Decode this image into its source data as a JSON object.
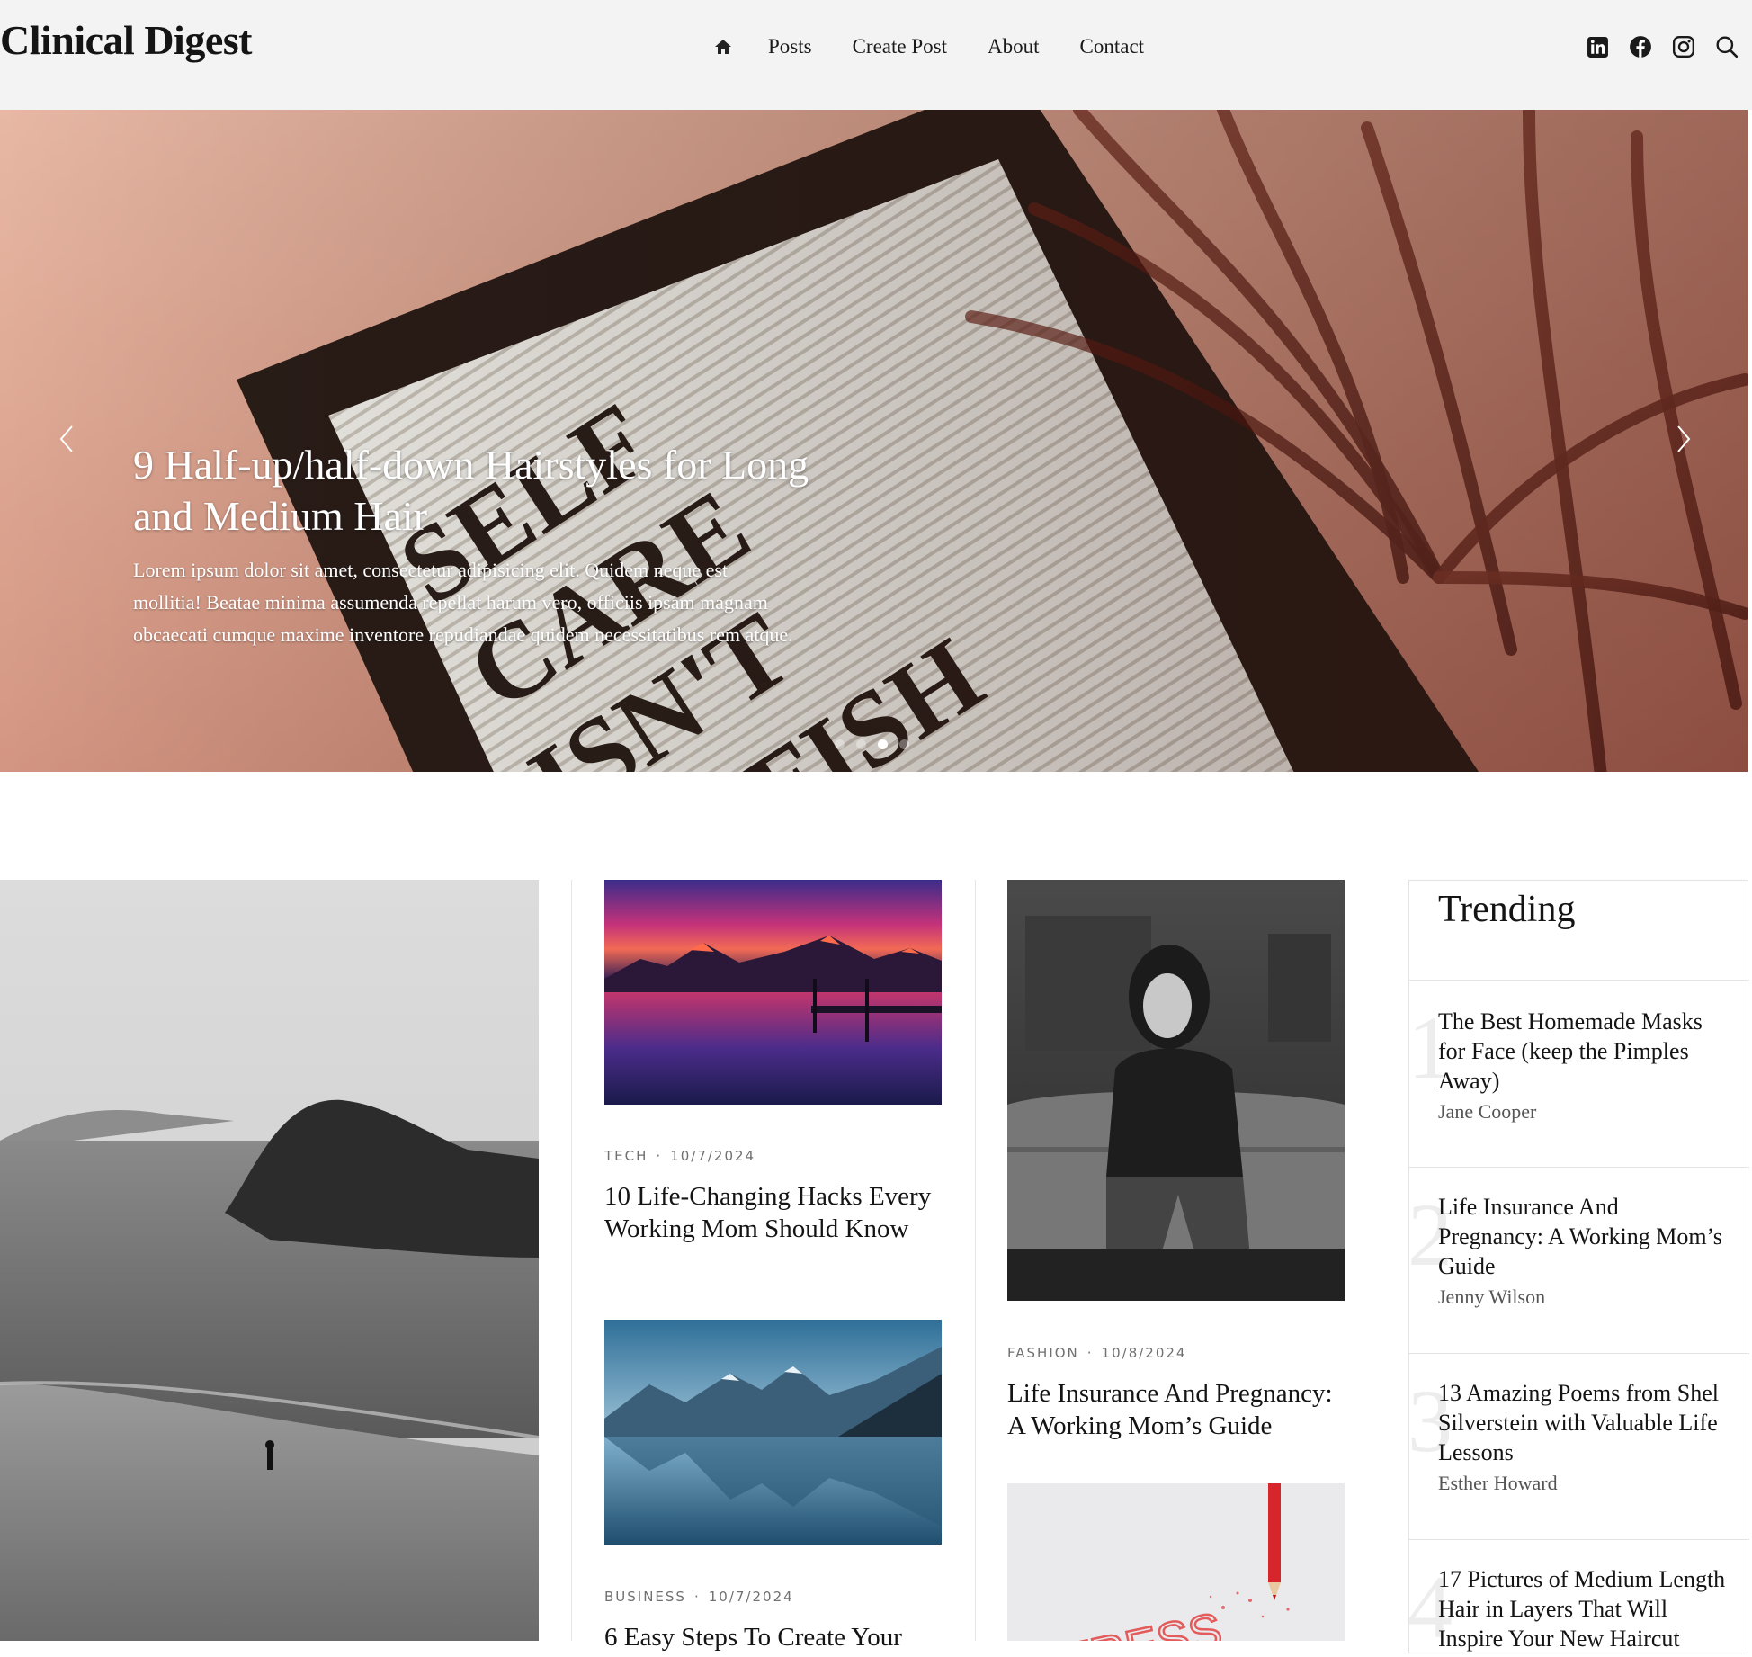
{
  "site": {
    "logo": "Clinical Digest"
  },
  "nav": {
    "home_icon": "home-icon",
    "items": [
      "Posts",
      "Create Post",
      "About",
      "Contact"
    ]
  },
  "social": [
    "linkedin-icon",
    "facebook-icon",
    "instagram-icon",
    "search-icon"
  ],
  "hero": {
    "title": "9 Half-up/half-down Hairstyles for Long and Medium Hair",
    "text": "Lorem ipsum dolor sit amet, consectetur adipisicing elit. Quidem neque est mollitia! Beatae minima assumenda repellat harum vero, officiis ipsam magnam obcaecati cumque maxime inventore repudiandae quidem necessitatibus rem atque.",
    "board_text": [
      "SELF",
      "CARE",
      "ISN'T",
      "SELFISH"
    ],
    "slides_count": 4,
    "active_slide": 3
  },
  "posts": [
    {
      "category": "TECH",
      "date": "10/7/2024",
      "title": "10 Life-Changing Hacks Every Working Mom Should Know"
    },
    {
      "category": "BUSINESS",
      "date": "10/7/2024",
      "title": "6 Easy Steps To Create Your"
    },
    {
      "category": "FASHION",
      "date": "10/8/2024",
      "title": "Life Insurance And Pregnancy: A Working Mom’s Guide"
    }
  ],
  "trending": {
    "heading": "Trending",
    "items": [
      {
        "num": "1",
        "title": "The Best Homemade Masks for Face (keep the Pimples Away)",
        "author": "Jane Cooper"
      },
      {
        "num": "2",
        "title": "Life Insurance And Pregnancy: A Working Mom’s Guide",
        "author": "Jenny Wilson"
      },
      {
        "num": "3",
        "title": "13 Amazing Poems from Shel Silverstein with Valuable Life Lessons",
        "author": "Esther Howard"
      },
      {
        "num": "4",
        "title": "17 Pictures of Medium Length Hair in Layers That Will Inspire Your New Haircut",
        "author": ""
      }
    ]
  },
  "colors": {
    "header_bg": "#f3f3f3",
    "hero_accent": "#d69a86",
    "text": "#141414"
  }
}
